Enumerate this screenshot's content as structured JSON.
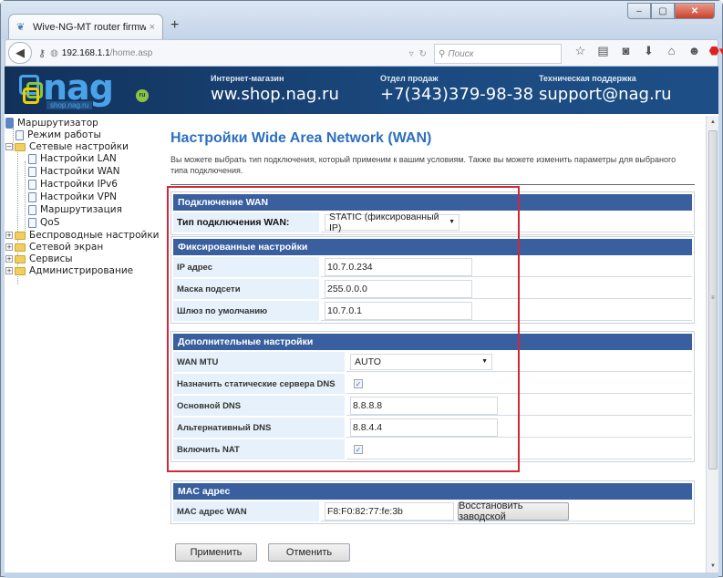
{
  "browser": {
    "tab_title": "Wive-NG-MT router firmw...",
    "tab_favicon": "leaf-icon",
    "tab_close": "×",
    "new_tab": "+",
    "url_host": "192.168.1.1",
    "url_path": "/home.asp",
    "search_placeholder": "Поиск",
    "window_buttons": {
      "minimize": "–",
      "maximize": "▢",
      "close": "✕"
    },
    "toolbar_icons": [
      "star-icon",
      "reading-list-icon",
      "pocket-icon",
      "download-icon",
      "home-icon",
      "hello-icon",
      "adblock-icon",
      "menu-icon"
    ]
  },
  "banner": {
    "logo_text": "nag",
    "logo_sub": "shop.nag.ru",
    "logo_badge": "ru",
    "shop_label": "Интернет-магазин",
    "shop_value": "ww.shop.nag.ru",
    "sales_label": "Отдел продаж",
    "sales_value": "+7(343)379-98-38",
    "support_label": "Техническая поддержка",
    "support_value": "support@nag.ru"
  },
  "sidebar": {
    "root": "Маршрутизатор",
    "items": [
      {
        "label": "Режим работы",
        "type": "page",
        "level": 1
      },
      {
        "label": "Сетевые настройки",
        "type": "folder",
        "level": 1,
        "expanded": true
      },
      {
        "label": "Настройки LAN",
        "type": "page",
        "level": 2
      },
      {
        "label": "Настройки WAN",
        "type": "page",
        "level": 2
      },
      {
        "label": "Настройки IPv6",
        "type": "page",
        "level": 2
      },
      {
        "label": "Настройки VPN",
        "type": "page",
        "level": 2
      },
      {
        "label": "Маршрутизация",
        "type": "page",
        "level": 2
      },
      {
        "label": "QoS",
        "type": "page",
        "level": 2
      },
      {
        "label": "Беспроводные настройки",
        "type": "folder",
        "level": 1,
        "expanded": false
      },
      {
        "label": "Сетевой экран",
        "type": "folder",
        "level": 1,
        "expanded": false
      },
      {
        "label": "Сервисы",
        "type": "folder",
        "level": 1,
        "expanded": false
      },
      {
        "label": "Администрирование",
        "type": "folder",
        "level": 1,
        "expanded": false
      }
    ]
  },
  "page": {
    "title": "Настройки Wide Area Network (WAN)",
    "description": "Вы можете выбрать тип подключения, который применим к вашим условиям. Также вы можете изменить параметры для выбраного типа подключения."
  },
  "wan_connection": {
    "header": "Подключение WAN",
    "type_label": "Тип подключения WAN:",
    "type_value": "STATIC (фиксированный IP)"
  },
  "static_settings": {
    "header": "Фиксированные настройки",
    "ip_label": "IP адрес",
    "ip_value": "10.7.0.234",
    "mask_label": "Маска подсети",
    "mask_value": "255.0.0.0",
    "gateway_label": "Шлюз по умолчанию",
    "gateway_value": "10.7.0.1"
  },
  "extra_settings": {
    "header": "Дополнительные настройки",
    "mtu_label": "WAN MTU",
    "mtu_value": "AUTO",
    "static_dns_label": "Назначить статические сервера DNS",
    "static_dns_checked": true,
    "primary_dns_label": "Основной DNS",
    "primary_dns_value": "8.8.8.8",
    "secondary_dns_label": "Альтернативный DNS",
    "secondary_dns_value": "8.8.4.4",
    "nat_label": "Включить NAT",
    "nat_checked": true,
    "check_glyph": "✓"
  },
  "mac": {
    "header": "MAC адрес",
    "wan_label": "MAC адрес WAN",
    "wan_value": "F8:F0:82:77:fe:3b",
    "restore_button": "Восстановить заводской"
  },
  "actions": {
    "apply": "Применить",
    "cancel": "Отменить"
  },
  "colors": {
    "section_header": "#3a5f9f",
    "title": "#2c6fbf",
    "label_bg": "#e6f1fb",
    "highlight_box": "#d0283a",
    "banner": "#1b4a80"
  }
}
